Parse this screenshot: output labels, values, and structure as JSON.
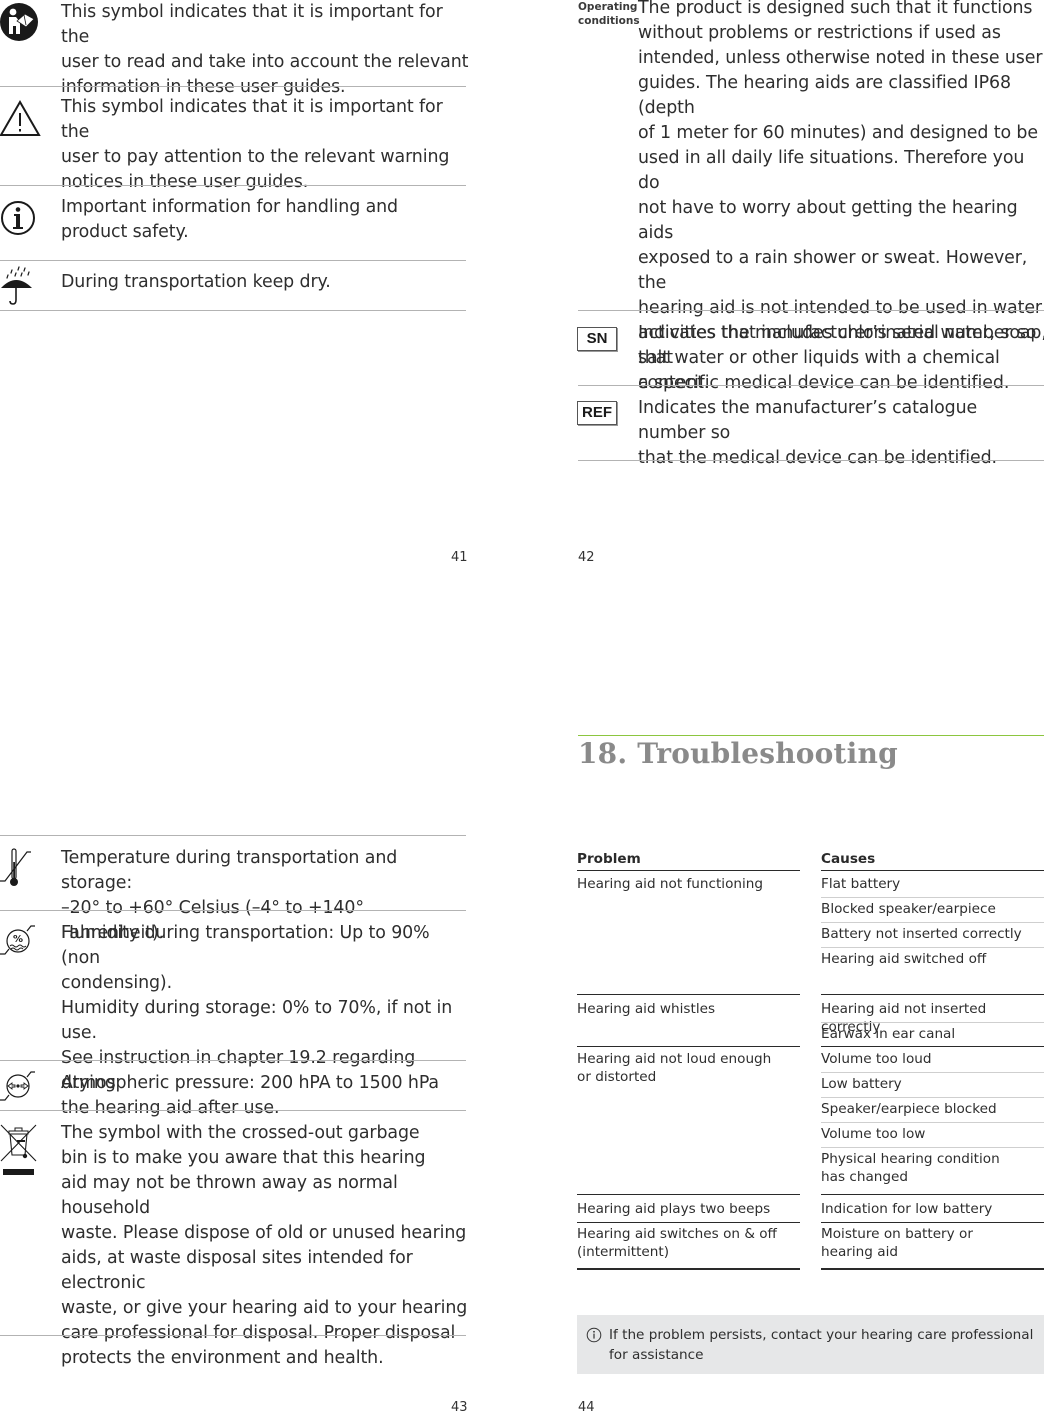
{
  "page41": {
    "page_number": "41",
    "symbols": [
      {
        "icon": "read-manual-icon",
        "text": "This symbol indicates that it is important for the\nuser to read and take into account the relevant\ninformation in these user guides."
      },
      {
        "icon": "warning-triangle-icon",
        "text": "This symbol indicates that it is important for the\nuser to pay attention to the relevant warning\nnotices in these user guides."
      },
      {
        "icon": "info-icon",
        "text": "Important information for handling and\nproduct safety."
      },
      {
        "icon": "umbrella-keep-dry-icon",
        "text": "During transportation keep dry."
      }
    ]
  },
  "page42": {
    "page_number": "42",
    "operating_conditions_label": "Operating\nconditions",
    "operating_conditions_text": "The product is designed such that it functions\nwithout problems or restrictions if used as\nintended, unless otherwise noted in these user\nguides. The hearing aids are classified IP68 (depth\nof 1 meter for 60 minutes) and designed to be\nused in all daily life situations. Therefore you do\nnot have to worry about getting the hearing aids\nexposed to a rain shower or sweat. However, the\nhearing aid is not intended to be used in water\nactivities that includes chlorinated water, soap,\nsalt water or other liquids with a chemical\ncontent.",
    "symbols": [
      {
        "icon": "serial-number-icon",
        "badge": "SN",
        "text": "Indicates the manufacturer’s serial number so that\na specific medical device can be identified."
      },
      {
        "icon": "catalogue-number-icon",
        "badge": "REF",
        "text": "Indicates the manufacturer’s catalogue number so\nthat the medical device can be identified."
      }
    ]
  },
  "page43": {
    "page_number": "43",
    "symbols": [
      {
        "icon": "temperature-limit-icon",
        "text": "Temperature during transportation and storage:\n–20° to +60° Celsius (–4° to +140° Fahrenheit)."
      },
      {
        "icon": "humidity-limit-icon",
        "text": "Humidity during transportation: Up to 90% (non\ncondensing).\nHumidity during storage: 0% to 70%, if not in use.\nSee instruction in chapter 19.2 regarding drying\nthe hearing aid after use."
      },
      {
        "icon": "atmospheric-pressure-icon",
        "text": "Atmospheric pressure: 200 hPA to 1500 hPa"
      },
      {
        "icon": "crossed-out-bin-icon",
        "text": "The symbol with the crossed-out garbage\nbin is to make you aware that this hearing\naid may not be thrown away as normal household\nwaste. Please dispose of old or unused hearing\naids, at waste disposal sites intended for electronic\nwaste, or give your hearing aid to your hearing\ncare professional for disposal. Proper disposal\nprotects the environment and health."
      }
    ]
  },
  "page44": {
    "page_number": "44",
    "section_title": "18. Troubleshooting",
    "accent_color": "#8cc63f",
    "table": {
      "headers": {
        "problem": "Problem",
        "causes": "Causes"
      },
      "rows": [
        {
          "problem": "Hearing aid not functioning",
          "causes": [
            "Flat battery",
            "Blocked speaker/earpiece",
            "Battery not inserted correctly",
            "Hearing aid switched off"
          ]
        },
        {
          "problem": "Hearing aid whistles",
          "causes": [
            "Hearing aid not inserted correctly",
            "Earwax in ear canal"
          ]
        },
        {
          "problem": "Hearing aid not loud enough\nor distorted",
          "causes": [
            "Volume too loud",
            "Low battery",
            "Speaker/earpiece blocked",
            "Volume too low",
            "Physical hearing condition\nhas changed"
          ]
        },
        {
          "problem": "Hearing aid plays two beeps",
          "causes": [
            "Indication for low battery"
          ]
        },
        {
          "problem": "Hearing aid switches on & off\n(intermittent)",
          "causes": [
            "Moisture on battery or\nhearing aid"
          ]
        }
      ]
    },
    "note": {
      "icon": "info-icon",
      "text": "If the problem persists, contact your hearing care professional\nfor assistance"
    }
  }
}
